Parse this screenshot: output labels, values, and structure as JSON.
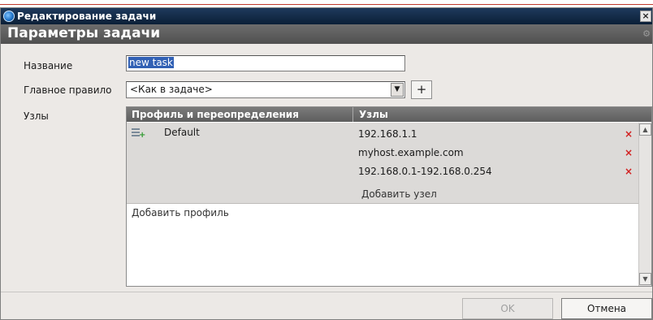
{
  "window": {
    "title": "Редактирование задачи",
    "close_glyph": "×"
  },
  "header": {
    "heading": "Параметры задачи",
    "gear_glyph": "⚙"
  },
  "form": {
    "name_label": "Название",
    "name_value": "new task",
    "rule_label": "Главное правило",
    "rule_value": "<Как в задаче>",
    "add_rule_label": "+",
    "nodes_label": "Узлы"
  },
  "grid": {
    "col_profiles": "Профиль и переопределения",
    "col_nodes": "Узлы",
    "profile": {
      "name": "Default",
      "hosts": [
        "192.168.1.1",
        "myhost.example.com",
        "192.168.0.1-192.168.0.254"
      ],
      "delete_glyph": "×",
      "add_host_label": "Добавить узел"
    },
    "add_profile_label": "Добавить профиль"
  },
  "footer": {
    "ok_label": "OK",
    "cancel_label": "Отмена"
  },
  "colors": {
    "titlebar": "#0b1f37",
    "header": "#5d5d5d",
    "delete": "#d21f1f",
    "selection": "#3160b4"
  }
}
